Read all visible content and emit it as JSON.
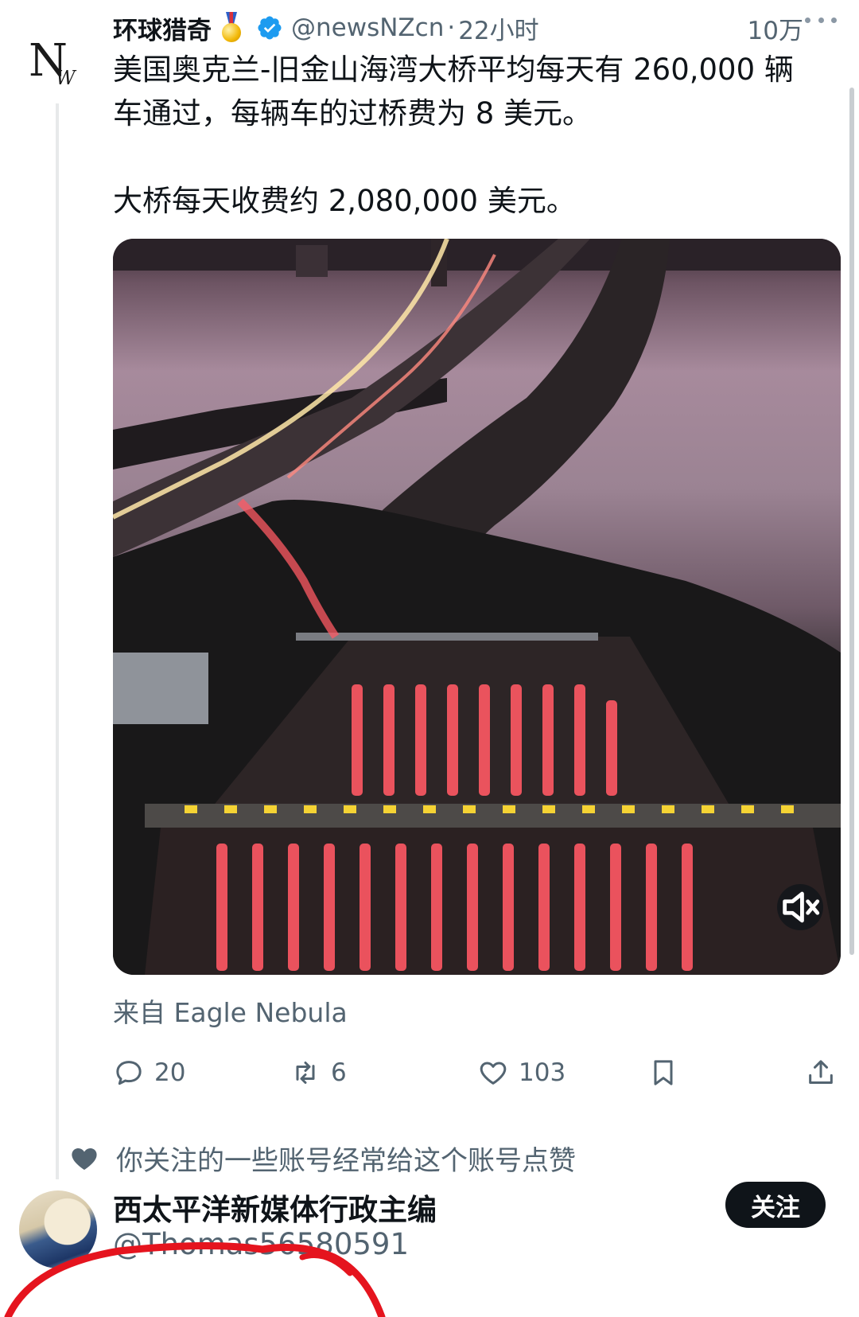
{
  "tweet": {
    "avatar_letters": {
      "first": "N",
      "second": "W"
    },
    "display_name": "环球猎奇",
    "badge_icon": "medal-icon",
    "verified_icon": "verified-badge-icon",
    "handle": "@newsNZcn",
    "separator": "·",
    "time": "22小时",
    "views": "10万",
    "more_icon": "more-options-icon",
    "text_paragraphs": [
      "美国奥克兰-旧金山海湾大桥平均每天有 260,000 辆车通过，每辆车的过桥费为 8 美元。",
      "大桥每天收费约 2,080,000 美元。"
    ],
    "media": {
      "kind": "video",
      "mute_icon": "speaker-muted-icon"
    },
    "source": "来自 Eagle Nebula",
    "actions": {
      "reply": {
        "icon": "reply-icon",
        "count": "20"
      },
      "retweet": {
        "icon": "retweet-icon",
        "count": "6"
      },
      "like": {
        "icon": "heart-icon",
        "count": "103"
      },
      "bookmark": {
        "icon": "bookmark-icon"
      },
      "share": {
        "icon": "share-icon"
      }
    }
  },
  "social_context": {
    "icon": "heart-icon",
    "text": "你关注的一些账号经常给这个账号点赞"
  },
  "suggestion": {
    "name": "西太平洋新媒体行政主编",
    "handle": "@Thomas56580591",
    "follow_label": "关注"
  },
  "colors": {
    "text_primary": "#0f1419",
    "text_secondary": "#536471",
    "verified_blue": "#1d9bf0",
    "annotation_red": "#e5141e"
  }
}
